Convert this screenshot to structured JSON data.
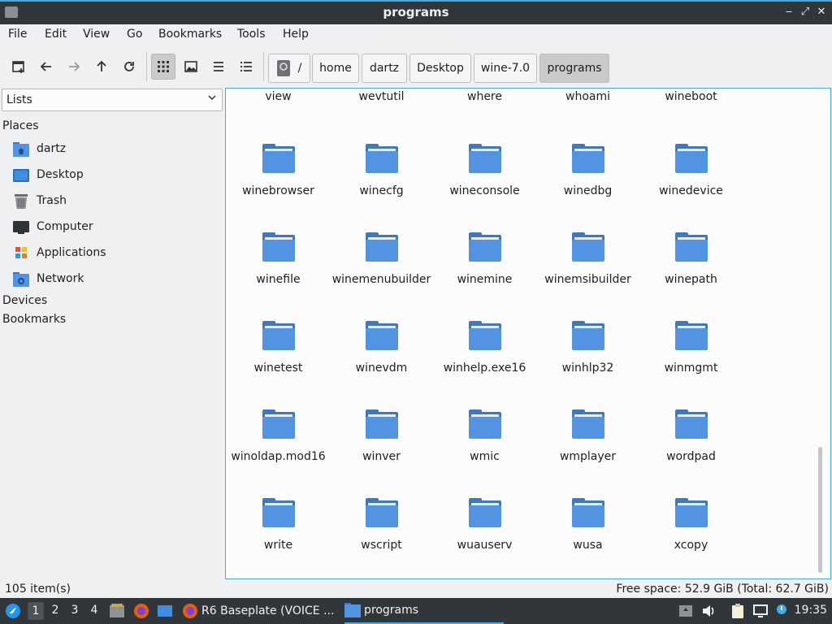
{
  "window": {
    "title": "programs",
    "controls": {
      "minimize": "‒",
      "maximize": "⤢",
      "close": "✕"
    }
  },
  "menu": [
    "File",
    "Edit",
    "View",
    "Go",
    "Bookmarks",
    "Tools",
    "Help"
  ],
  "toolbar": {
    "icons": [
      "new-tab-icon",
      "back-arrow-icon",
      "forward-arrow-icon",
      "up-arrow-icon",
      "reload-icon",
      "icon-view-icon",
      "thumbnail-view-icon",
      "compact-view-icon",
      "detailed-list-view-icon"
    ],
    "path": [
      {
        "label": "/",
        "icon": "drive-icon"
      },
      {
        "label": "home"
      },
      {
        "label": "dartz"
      },
      {
        "label": "Desktop"
      },
      {
        "label": "wine-7.0"
      },
      {
        "label": "programs",
        "current": true
      }
    ]
  },
  "sidebar": {
    "selector": "Lists",
    "places_label": "Places",
    "places": [
      {
        "label": "dartz",
        "icon": "home-folder-icon"
      },
      {
        "label": "Desktop",
        "icon": "desktop-icon"
      },
      {
        "label": "Trash",
        "icon": "trash-icon"
      },
      {
        "label": "Computer",
        "icon": "computer-icon"
      },
      {
        "label": "Applications",
        "icon": "applications-icon"
      },
      {
        "label": "Network",
        "icon": "network-icon"
      }
    ],
    "devices_label": "Devices",
    "bookmarks_label": "Bookmarks"
  },
  "files": {
    "partial_row": [
      "view",
      "wevtutil",
      "where",
      "whoami",
      "wineboot"
    ],
    "rows": [
      [
        "winebrowser",
        "winecfg",
        "wineconsole",
        "winedbg",
        "winedevice"
      ],
      [
        "winefile",
        "winemenubuilder",
        "winemine",
        "winemsibuilder",
        "winepath"
      ],
      [
        "winetest",
        "winevdm",
        "winhelp.exe16",
        "winhlp32",
        "winmgmt"
      ],
      [
        "winoldap.mod16",
        "winver",
        "wmic",
        "wmplayer",
        "wordpad"
      ],
      [
        "write",
        "wscript",
        "wuauserv",
        "wusa",
        "xcopy"
      ]
    ]
  },
  "status": {
    "items": "105 item(s)",
    "free_space": "Free space: 52.9 GiB (Total: 62.7 GiB)"
  },
  "taskbar": {
    "workspaces": [
      "1",
      "2",
      "3",
      "4"
    ],
    "tasks": [
      {
        "label": "R6 Baseplate (VOICE ...",
        "icon": "firefox-icon"
      },
      {
        "label": "programs",
        "icon": "folder-icon",
        "active": true
      }
    ],
    "clock": "19:35"
  },
  "colors": {
    "accent": "#3daee9",
    "folder_front": "#5294e2",
    "folder_back": "#3f78c1",
    "titlebar": "#31363b"
  }
}
